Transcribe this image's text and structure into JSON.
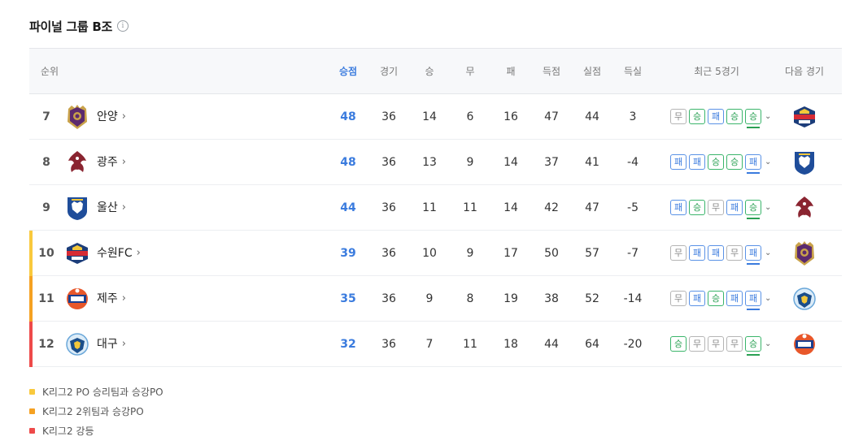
{
  "header": {
    "title": "파이널 그룹 B조",
    "info_icon": "i"
  },
  "columns": {
    "rank": "순위",
    "points": "승점",
    "played": "경기",
    "won": "승",
    "drawn": "무",
    "lost": "패",
    "goals_for": "득점",
    "goals_against": "실점",
    "goal_diff": "득실",
    "recent": "최근 5경기",
    "next": "다음 경기"
  },
  "rows": [
    {
      "rank": "7",
      "team": "안양",
      "chevron": "›",
      "points": "48",
      "played": "36",
      "won": "14",
      "drawn": "6",
      "lost": "16",
      "gf": "47",
      "ga": "44",
      "gd": "3",
      "form": [
        "무",
        "승",
        "패",
        "승",
        "승"
      ],
      "next": "수원FC",
      "zone": ""
    },
    {
      "rank": "8",
      "team": "광주",
      "chevron": "›",
      "points": "48",
      "played": "36",
      "won": "13",
      "drawn": "9",
      "lost": "14",
      "gf": "37",
      "ga": "41",
      "gd": "-4",
      "form": [
        "패",
        "패",
        "승",
        "승",
        "패"
      ],
      "next": "울산",
      "zone": ""
    },
    {
      "rank": "9",
      "team": "울산",
      "chevron": "›",
      "points": "44",
      "played": "36",
      "won": "11",
      "drawn": "11",
      "lost": "14",
      "gf": "42",
      "ga": "47",
      "gd": "-5",
      "form": [
        "패",
        "승",
        "무",
        "패",
        "승"
      ],
      "next": "광주",
      "zone": ""
    },
    {
      "rank": "10",
      "team": "수원FC",
      "chevron": "›",
      "points": "39",
      "played": "36",
      "won": "10",
      "drawn": "9",
      "lost": "17",
      "gf": "50",
      "ga": "57",
      "gd": "-7",
      "form": [
        "무",
        "패",
        "패",
        "무",
        "패"
      ],
      "next": "안양",
      "zone": "#f9c93d"
    },
    {
      "rank": "11",
      "team": "제주",
      "chevron": "›",
      "points": "35",
      "played": "36",
      "won": "9",
      "drawn": "8",
      "lost": "19",
      "gf": "38",
      "ga": "52",
      "gd": "-14",
      "form": [
        "무",
        "패",
        "승",
        "패",
        "패"
      ],
      "next": "대구",
      "zone": "#f5a122"
    },
    {
      "rank": "12",
      "team": "대구",
      "chevron": "›",
      "points": "32",
      "played": "36",
      "won": "7",
      "drawn": "11",
      "lost": "18",
      "gf": "44",
      "ga": "64",
      "gd": "-20",
      "form": [
        "승",
        "무",
        "무",
        "무",
        "승"
      ],
      "next": "제주",
      "zone": "#ee4a4a"
    }
  ],
  "legend": [
    {
      "color": "#f9c93d",
      "label": "K리그2 PO 승리팀과 승강PO"
    },
    {
      "color": "#f5a122",
      "label": "K리그2 2위팀과 승강PO"
    },
    {
      "color": "#ee4a4a",
      "label": "K리그2 강등"
    }
  ],
  "icons": {
    "expand": "chevron-down-icon",
    "team_link": "chevron-right-icon"
  }
}
